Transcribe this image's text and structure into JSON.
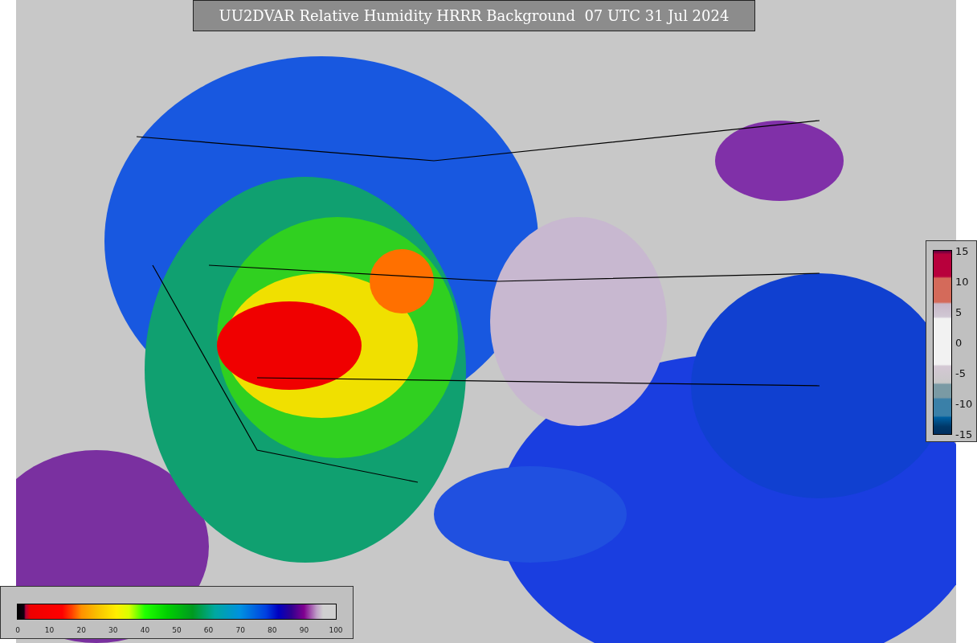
{
  "title": "UU2DVAR Relative Humidity HRRR Background  07 UTC 31 Jul 2024",
  "humidity_legend": {
    "ticks": [
      "0",
      "10",
      "20",
      "30",
      "40",
      "50",
      "60",
      "70",
      "80",
      "90",
      "100"
    ]
  },
  "difference_legend": {
    "ticks": [
      "15",
      "10",
      "5",
      "0",
      "-5",
      "-10",
      "-15"
    ]
  }
}
